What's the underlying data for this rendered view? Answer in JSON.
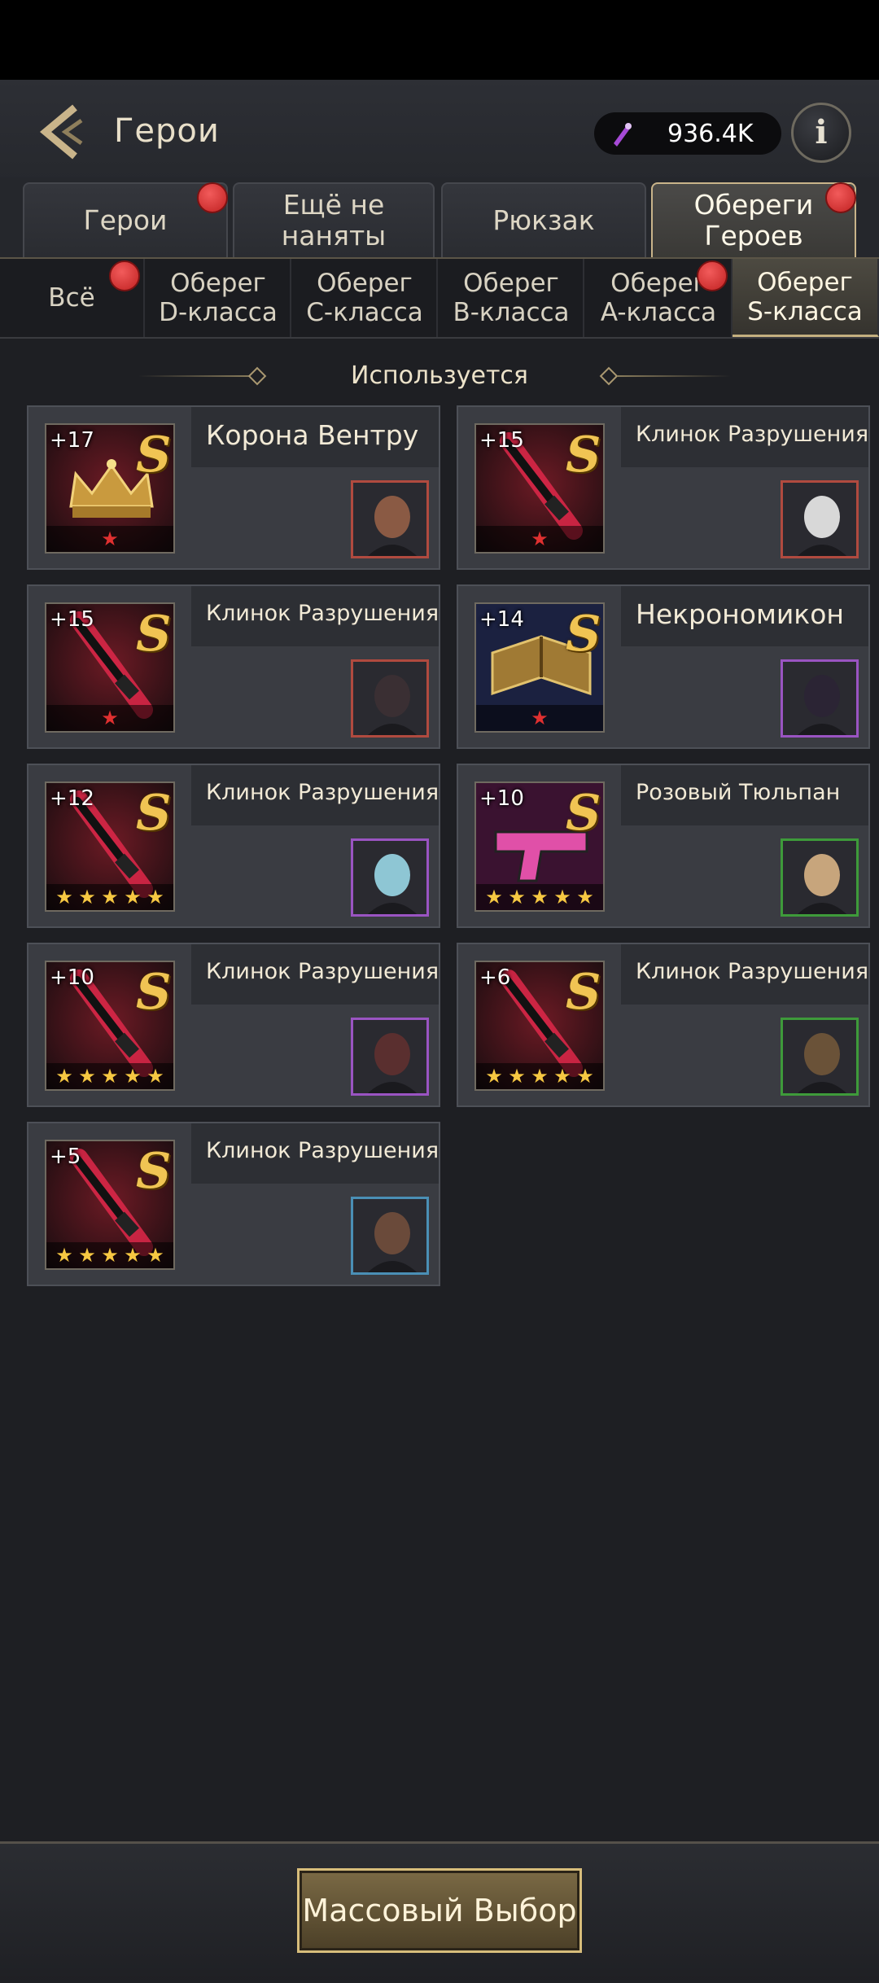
{
  "header": {
    "title": "Герои",
    "currency_amount": "936.4K"
  },
  "tabs": [
    {
      "label": "Герои",
      "badge": true
    },
    {
      "label": "Ещё не наняты",
      "badge": false
    },
    {
      "label": "Рюкзак",
      "badge": false
    },
    {
      "label": "Обереги Героев",
      "badge": true,
      "active": true
    }
  ],
  "subtabs": [
    {
      "label": "Всё",
      "badge": true
    },
    {
      "label": "Оберег D-класса"
    },
    {
      "label": "Оберег C-класса"
    },
    {
      "label": "Оберег B-класса"
    },
    {
      "label": "Оберег A-класса",
      "badge": true
    },
    {
      "label": "Оберег S-класса",
      "active": true
    }
  ],
  "section_title": "Используется",
  "cards": [
    {
      "name": "Корона Вентру",
      "level": "+17",
      "grade": "S",
      "item": "crown",
      "stars": 1,
      "star_color": "red"
    },
    {
      "name": "Клинок Разрушения",
      "level": "+15",
      "grade": "S",
      "item": "blade",
      "stars": 1,
      "star_color": "red"
    },
    {
      "name": "Клинок Разрушения",
      "level": "+15",
      "grade": "S",
      "item": "blade",
      "stars": 1,
      "star_color": "red"
    },
    {
      "name": "Некрономикон",
      "level": "+14",
      "grade": "S",
      "item": "book",
      "stars": 1,
      "star_color": "red"
    },
    {
      "name": "Клинок Разрушения",
      "level": "+12",
      "grade": "S",
      "item": "blade",
      "stars": 5,
      "star_color": "gold"
    },
    {
      "name": "Розовый Тюльпан",
      "level": "+10",
      "grade": "S",
      "item": "pistol",
      "stars": 5,
      "star_color": "gold"
    },
    {
      "name": "Клинок Разрушения",
      "level": "+10",
      "grade": "S",
      "item": "blade",
      "stars": 5,
      "star_color": "gold"
    },
    {
      "name": "Клинок Разрушения",
      "level": "+6",
      "grade": "S",
      "item": "blade",
      "stars": 5,
      "star_color": "gold"
    },
    {
      "name": "Клинок Разрушения",
      "level": "+5",
      "grade": "S",
      "item": "blade",
      "stars": 5,
      "star_color": "gold"
    }
  ],
  "footer": {
    "mass_select_label": "Массовый Выбор"
  }
}
